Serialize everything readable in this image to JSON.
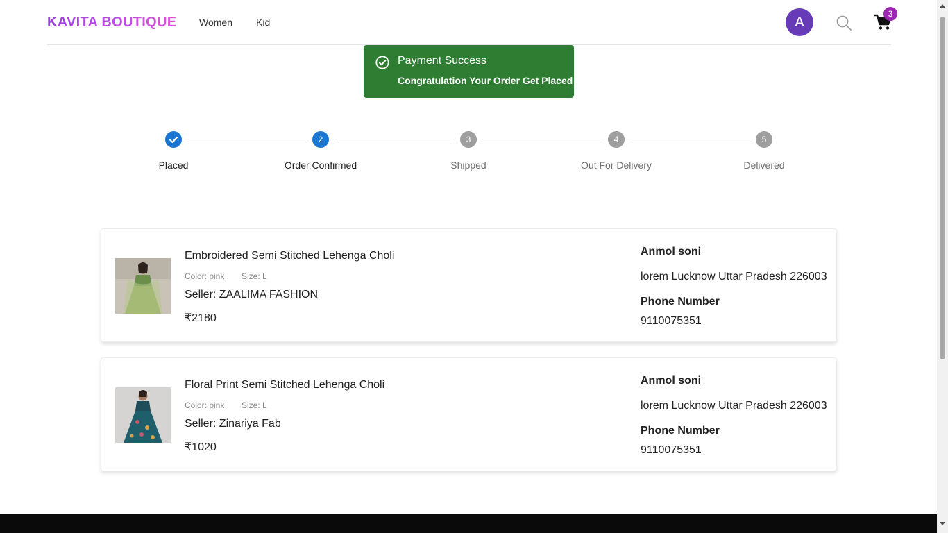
{
  "brand": "KAVITA BOUTIQUE",
  "nav": [
    "Women",
    "Kid"
  ],
  "header": {
    "avatar_letter": "A",
    "cart_count": "3",
    "search_icon": "search-icon",
    "cart_icon": "cart-icon"
  },
  "toast": {
    "title": "Payment Success",
    "message": "Congratulation Your Order Get Placed",
    "icon": "check-circle-icon",
    "color": "#2e7d32"
  },
  "steps": [
    {
      "num": "",
      "label": "Placed",
      "state": "done"
    },
    {
      "num": "2",
      "label": "Order Confirmed",
      "state": "active"
    },
    {
      "num": "3",
      "label": "Shipped",
      "state": "pending"
    },
    {
      "num": "4",
      "label": "Out For Delivery",
      "state": "pending"
    },
    {
      "num": "5",
      "label": "Delivered",
      "state": "pending"
    }
  ],
  "orders": [
    {
      "title": "Embroidered Semi Stitched Lehenga Choli",
      "color": "Color: pink",
      "size": "Size: L",
      "seller": "Seller: ZAALIMA FASHION",
      "price": "₹2180",
      "name": "Anmol soni",
      "address": "lorem Lucknow Uttar Pradesh 226003",
      "phone_label": "Phone Number",
      "phone": "9110075351"
    },
    {
      "title": "Floral Print Semi Stitched Lehenga Choli",
      "color": "Color: pink",
      "size": "Size: L",
      "seller": "Seller: Zinariya Fab",
      "price": "₹1020",
      "name": "Anmol soni",
      "address": "lorem Lucknow Uttar Pradesh 226003",
      "phone_label": "Phone Number",
      "phone": "9110075351"
    }
  ],
  "colors": {
    "step_active": "#1976d2",
    "step_pending": "#9e9e9e",
    "avatar": "#673ab7",
    "badge": "#9c27b0"
  }
}
